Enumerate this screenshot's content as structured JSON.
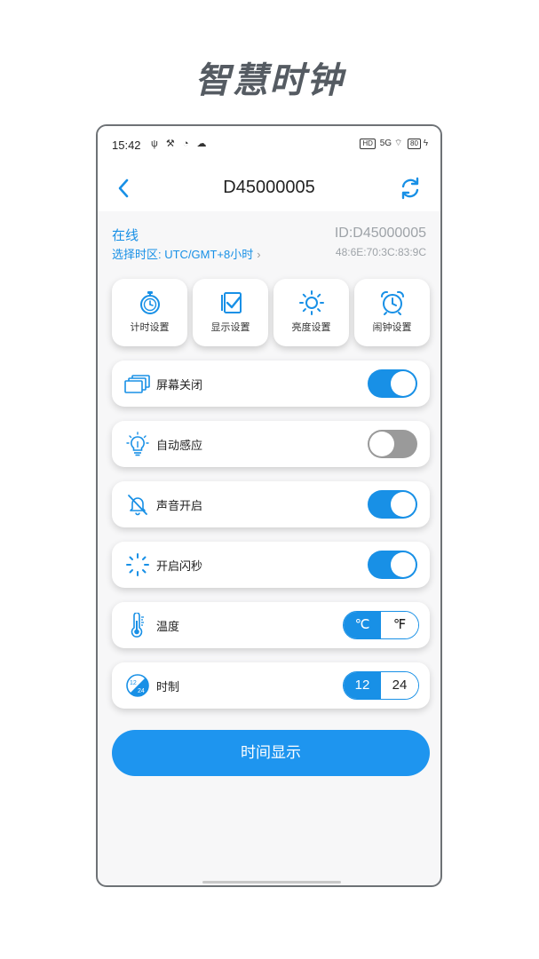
{
  "promo": {
    "title": "智慧时钟"
  },
  "status_bar": {
    "time": "15:42",
    "left_icons": "ψ ⚒ ◔ ☁",
    "hd": "HD",
    "network": "5G",
    "battery": "80"
  },
  "nav": {
    "title": "D45000005"
  },
  "info": {
    "status": "在线",
    "timezone": "选择时区: UTC/GMT+8小时",
    "device_id": "ID:D45000005",
    "mac": "48:6E:70:3C:83:9C"
  },
  "tiles": [
    {
      "label": "计时设置",
      "icon": "stopwatch-icon"
    },
    {
      "label": "显示设置",
      "icon": "display-check-icon"
    },
    {
      "label": "亮度设置",
      "icon": "sun-icon"
    },
    {
      "label": "闹钟设置",
      "icon": "alarm-clock-icon"
    }
  ],
  "settings": {
    "screen_off": {
      "label": "屏幕关闭",
      "on": true,
      "icon": "screens-icon"
    },
    "auto_sense": {
      "label": "自动感应",
      "on": false,
      "icon": "bulb-icon"
    },
    "sound": {
      "label": "声音开启",
      "on": true,
      "icon": "bell-off-icon"
    },
    "flash_seconds": {
      "label": "开启闪秒",
      "on": true,
      "icon": "loading-spinner-icon"
    },
    "temperature": {
      "label": "温度",
      "options": [
        "℃",
        "℉"
      ],
      "selected": "℃",
      "icon": "thermometer-icon"
    },
    "hour_format": {
      "label": "时制",
      "options": [
        "12",
        "24"
      ],
      "selected": "12",
      "icon": "12-24-icon"
    }
  },
  "actions": {
    "time_display": "时间显示"
  },
  "colors": {
    "accent": "#1890e6",
    "toggle_off": "#9a9a9a",
    "button": "#1e95ef"
  }
}
